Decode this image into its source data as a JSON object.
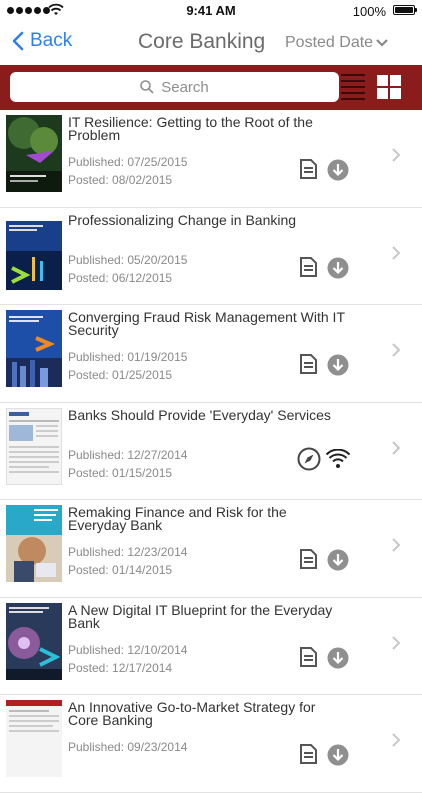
{
  "status_bar": {
    "time": "9:41 AM",
    "battery": "100%"
  },
  "nav": {
    "back_label": "Back",
    "title": "Core Banking",
    "sort_label": "Posted Date"
  },
  "search": {
    "placeholder": "Search"
  },
  "colors": {
    "accent_blue": "#2f80ed",
    "band_red": "#8b1c1c",
    "icon_gray": "#555555"
  },
  "items": [
    {
      "title": "IT Resilience: Getting to the Root of the Problem",
      "published": "Published: 07/25/2015",
      "posted": "Posted: 08/02/2015",
      "type": "document",
      "icons": [
        "document-icon",
        "download-icon"
      ]
    },
    {
      "title": "Professionalizing Change in Banking",
      "published": "Published: 05/20/2015",
      "posted": "Posted: 06/12/2015",
      "type": "document",
      "icons": [
        "document-icon",
        "download-icon"
      ]
    },
    {
      "title": "Converging Fraud Risk Management With IT Security",
      "published": "Published: 01/19/2015",
      "posted": "Posted: 01/25/2015",
      "type": "document",
      "icons": [
        "document-icon",
        "download-icon"
      ]
    },
    {
      "title": "Banks Should Provide 'Everyday' Services",
      "published": "Published: 12/27/2014",
      "posted": "Posted: 01/15/2015",
      "type": "web",
      "icons": [
        "compass-icon",
        "wifi-icon"
      ]
    },
    {
      "title": "Remaking Finance and Risk for the Everyday Bank",
      "published": "Published: 12/23/2014",
      "posted": "Posted: 01/14/2015",
      "type": "document",
      "icons": [
        "document-icon",
        "download-icon"
      ]
    },
    {
      "title": "A New Digital IT Blueprint for the Everyday Bank",
      "published": "Published: 12/10/2014",
      "posted": "Posted: 12/17/2014",
      "type": "document",
      "icons": [
        "document-icon",
        "download-icon"
      ]
    },
    {
      "title": "An Innovative Go-to-Market Strategy for Core Banking",
      "published": "Published: 09/23/2014",
      "posted": "",
      "type": "document",
      "icons": [
        "document-icon",
        "download-icon"
      ]
    }
  ]
}
